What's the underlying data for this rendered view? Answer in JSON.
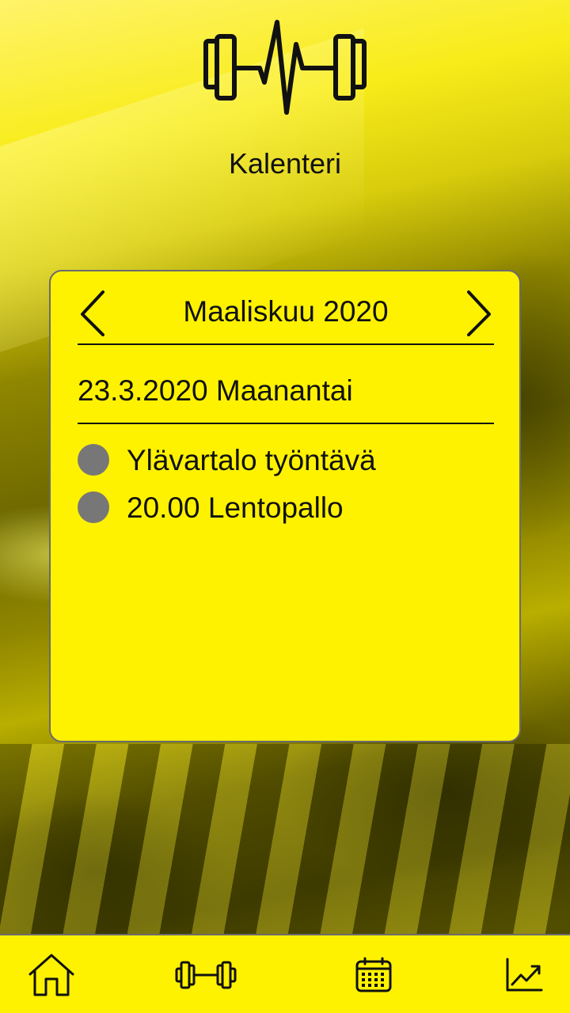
{
  "app": {
    "page_title": "Kalenteri"
  },
  "calendar": {
    "month_label": "Maaliskuu 2020",
    "selected_date": "23.3.2020 Maanantai",
    "events": [
      {
        "label": "Ylävartalo työntävä",
        "dot_color": "#777777"
      },
      {
        "label": "20.00 Lentopallo",
        "dot_color": "#777777"
      }
    ]
  },
  "icons": {
    "logo": "dumbbell-heartbeat-icon",
    "prev": "chevron-left-icon",
    "next": "chevron-right-icon",
    "home": "home-icon",
    "workouts": "dumbbell-icon",
    "calendar": "calendar-icon",
    "stats": "trend-chart-icon"
  },
  "theme": {
    "accent": "#fff200",
    "ink": "#111111",
    "border": "#6b6b6b"
  }
}
